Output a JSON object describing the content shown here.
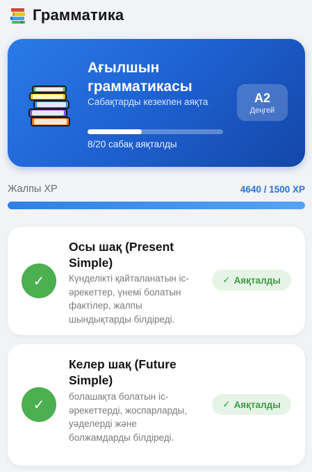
{
  "header": {
    "icon": "books-icon",
    "title": "Грамматика"
  },
  "hero": {
    "icon": "books-stack-icon",
    "title": "Ағылшын грамматикасы",
    "subtitle": "Сабақтарды кезекпен аяқта",
    "progress_fraction": 0.4,
    "progress_text": "8/20 сабақ аяқталды",
    "level": {
      "code": "A2",
      "label": "Деңгей"
    },
    "colors": {
      "gradient_start": "#2a7ae8",
      "gradient_end": "#1446a8"
    }
  },
  "xp": {
    "label": "Жалпы XP",
    "value_text": "4640 / 1500 XP",
    "progress_fraction": 1.0,
    "accent": "#2a6fd6"
  },
  "lessons": [
    {
      "title": "Осы шақ (Present Simple)",
      "description": "Күнделікті қайталанатын іс-әрекеттер, үнемі болатын фактілер, жалпы шындықтарды білдіреді.",
      "status_icon": "check-icon",
      "status_label": "Аяқталды",
      "status_tick": "✓"
    },
    {
      "title": "Келер шақ (Future Simple)",
      "description": "болашақта болатын іс-әрекеттерді, жоспарларды, уәделерді және болжамдарды білдіреді.",
      "status_icon": "check-icon",
      "status_label": "Аяқталды",
      "status_tick": "✓"
    }
  ],
  "colors": {
    "success": "#4caf50",
    "success_bg": "#e6f4e7",
    "page_bg": "#f1f3f6"
  }
}
